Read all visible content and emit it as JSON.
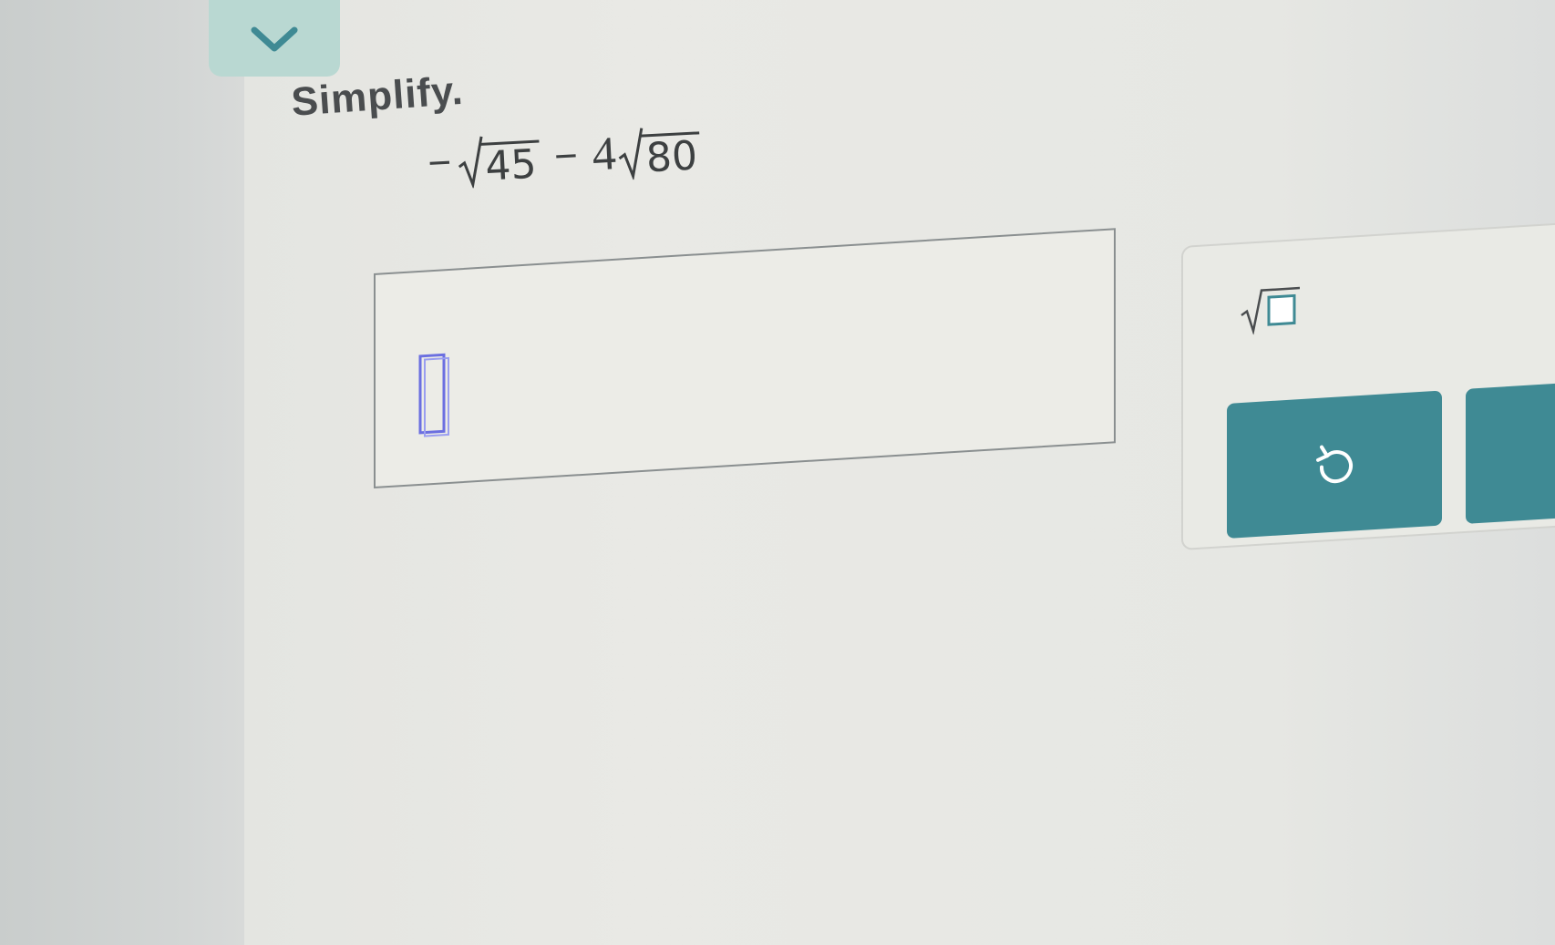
{
  "question": {
    "prompt": "Simplify.",
    "expression": {
      "term1": {
        "sign": "−",
        "radicand": "45"
      },
      "operator": "−",
      "term2": {
        "coefficient": "4",
        "radicand": "80"
      }
    }
  },
  "answer": {
    "value": ""
  },
  "keypad": {
    "keys": [
      {
        "name": "sqrt-template-key",
        "icon": "sqrt-box-icon"
      },
      {
        "name": "undo-button",
        "icon": "undo-icon"
      }
    ]
  },
  "colors": {
    "accent": "#3f8a94",
    "tab": "#b9d8d2",
    "cursor": "#6b6fe0"
  }
}
